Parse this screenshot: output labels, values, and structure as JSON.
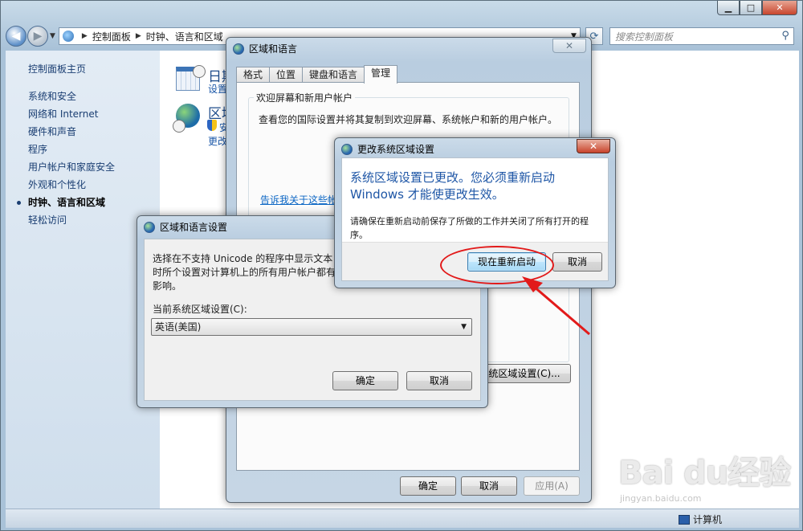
{
  "explorer": {
    "breadcrumb": [
      "控制面板",
      "时钟、语言和区域"
    ],
    "search_placeholder": "搜索控制面板",
    "sidebar_home": "控制面板主页",
    "sidebar_items": [
      "系统和安全",
      "网络和 Internet",
      "硬件和声音",
      "程序",
      "用户帐户和家庭安全",
      "外观和个性化",
      "时钟、语言和区域",
      "轻松访问"
    ],
    "active_item": "时钟、语言和区域",
    "categories": [
      {
        "title": "日期",
        "link": "设置"
      },
      {
        "title": "区域",
        "links": [
          "安",
          "更改"
        ]
      }
    ],
    "status_computer": "计算机"
  },
  "region_dialog": {
    "title": "区域和语言",
    "close": "✕",
    "tabs": [
      "格式",
      "位置",
      "键盘和语言",
      "管理"
    ],
    "active_tab": "管理",
    "group_title": "欢迎屏幕和新用户帐户",
    "group_desc": "查看您的国际设置并将其复制到欢迎屏幕、系统帐户和新的用户帐户。",
    "group_link": "告诉我关于这些帐",
    "change_locale_button": "统区域设置(C)...",
    "ok": "确定",
    "cancel": "取消",
    "apply": "应用(A)"
  },
  "settings_dialog": {
    "title": "区域和语言设置",
    "desc": "选择在不支持 Unicode 的程序中显示文本时所个设置对计算机上的所有用户帐户都有影响。",
    "locale_label": "当前系统区域设置(C):",
    "locale_value": "英语(美国)",
    "ok": "确定",
    "cancel": "取消"
  },
  "alert_dialog": {
    "title": "更改系统区域设置",
    "close": "✕",
    "message": "系统区域设置已更改。您必须重新启动 Windows 才能使更改生效。",
    "sub": "请确保在重新启动前保存了所做的工作并关闭了所有打开的程序。",
    "restart": "现在重新启动",
    "cancel": "取消"
  },
  "watermark": {
    "logo": "Bai du经验",
    "url": "jingyan.baidu.com"
  },
  "colors": {
    "highlight": "#e21a1a",
    "link": "#1a57a8",
    "message": "#1e56a6"
  }
}
